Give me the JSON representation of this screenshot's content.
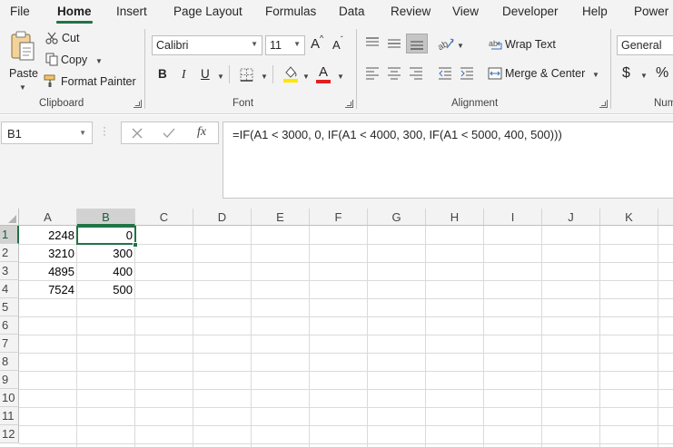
{
  "menu_tabs": [
    "File",
    "Home",
    "Insert",
    "Page Layout",
    "Formulas",
    "Data",
    "Review",
    "View",
    "Developer",
    "Help",
    "Power P"
  ],
  "active_tab": "Home",
  "colors": {
    "accent": "#217346",
    "font_color_bar": "#e02020",
    "highlight_bar": "#ffe600"
  },
  "clipboard": {
    "paste_label": "Paste",
    "cut_label": "Cut",
    "copy_label": "Copy",
    "format_painter_label": "Format Painter",
    "group_label": "Clipboard"
  },
  "font": {
    "font_name": "Calibri",
    "font_size": "11",
    "bold_label": "B",
    "italic_label": "I",
    "underline_label": "U",
    "grow_label": "A",
    "shrink_label": "A",
    "font_color_label": "A",
    "group_label": "Font"
  },
  "alignment": {
    "wrap_text_label": "Wrap Text",
    "merge_center_label": "Merge & Center",
    "group_label": "Alignment"
  },
  "number": {
    "format": "General",
    "currency_label": "$",
    "percent_label": "%",
    "group_label": "Num"
  },
  "formula_bar": {
    "name_box": "B1",
    "fx_label": "fx",
    "formula": "=IF(A1 < 3000, 0, IF(A1 < 4000, 300, IF(A1 < 5000, 400, 500)))"
  },
  "sheet": {
    "columns": [
      "A",
      "B",
      "C",
      "D",
      "E",
      "F",
      "G",
      "H",
      "I",
      "J",
      "K"
    ],
    "rows": [
      "1",
      "2",
      "3",
      "4",
      "5",
      "6",
      "7",
      "8",
      "9",
      "10",
      "11",
      "12"
    ],
    "selected_cell": "B1",
    "cells": [
      [
        "2248",
        "0"
      ],
      [
        "3210",
        "300"
      ],
      [
        "4895",
        "400"
      ],
      [
        "7524",
        "500"
      ]
    ]
  }
}
